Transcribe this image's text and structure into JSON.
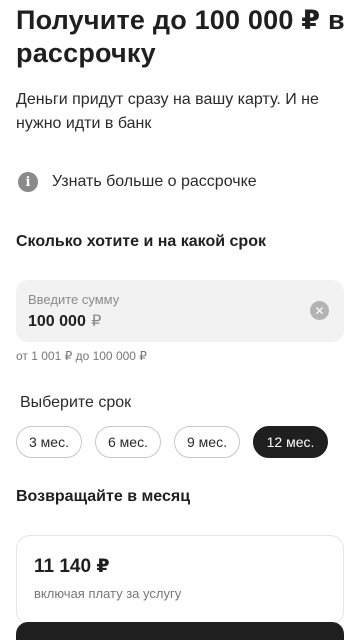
{
  "header": {
    "title": "Получите до 100 000 ₽ в рассрочку",
    "subtitle": "Деньги придут сразу на вашу карту. И не нужно идти в банк"
  },
  "info_link": {
    "icon": "info-icon",
    "label": "Узнать больше о рассрочке"
  },
  "amount_section": {
    "title": "Сколько хотите и на какой срок",
    "placeholder": "Введите сумму",
    "value": "100 000",
    "currency": "₽",
    "clear_icon": "close-icon",
    "range_hint": "от 1 001 ₽ до 100 000 ₽"
  },
  "term": {
    "label": "Выберите срок",
    "options": [
      "3 мес.",
      "6 мес.",
      "9 мес.",
      "12 мес."
    ],
    "selected": "12 мес."
  },
  "payment": {
    "title": "Возвращайте в месяц",
    "value": "11 140 ₽",
    "note": "включая плату за услугу"
  },
  "colors": {
    "text": "#1f1f1f",
    "field_bg": "#f2f2f2",
    "muted": "#8a8a8a",
    "selected_chip": "#1f1f1f"
  }
}
